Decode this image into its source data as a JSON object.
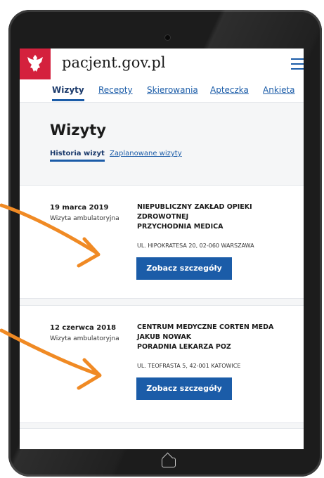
{
  "header": {
    "site_name": "pacjent.gov.pl"
  },
  "nav": {
    "tabs": [
      {
        "label": "Wizyty"
      },
      {
        "label": "Recepty"
      },
      {
        "label": "Skierowania"
      },
      {
        "label": "Apteczka"
      },
      {
        "label": "Ankieta"
      }
    ]
  },
  "page": {
    "title": "Wizyty",
    "subtabs": [
      {
        "label": "Historia wizyt"
      },
      {
        "label": "Zaplanowane wizyty"
      }
    ]
  },
  "visits": [
    {
      "date": "19 marca 2019",
      "kind": "Wizyta ambulatoryjna",
      "facility_lines": [
        "NIEPUBLICZNY ZAKŁAD OPIEKI",
        "ZDROWOTNEJ",
        "PRZYCHODNIA MEDICA"
      ],
      "address": "UL. HIPOKRATESA 20, 02-060 WARSZAWA",
      "button": "Zobacz szczegóły"
    },
    {
      "date": "12 czerwca 2018",
      "kind": "Wizyta ambulatoryjna",
      "facility_lines": [
        "CENTRUM MEDYCZNE CORTEN MEDA",
        "JAKUB NOWAK",
        "PORADNIA LEKARZA POZ"
      ],
      "address": "UL. TEOFRASTA 5, 42-001 KATOWICE",
      "button": "Zobacz szczegóły"
    }
  ],
  "colors": {
    "accent": "#1b5ca8",
    "brand_red": "#d4213d",
    "arrow": "#f08a24"
  }
}
